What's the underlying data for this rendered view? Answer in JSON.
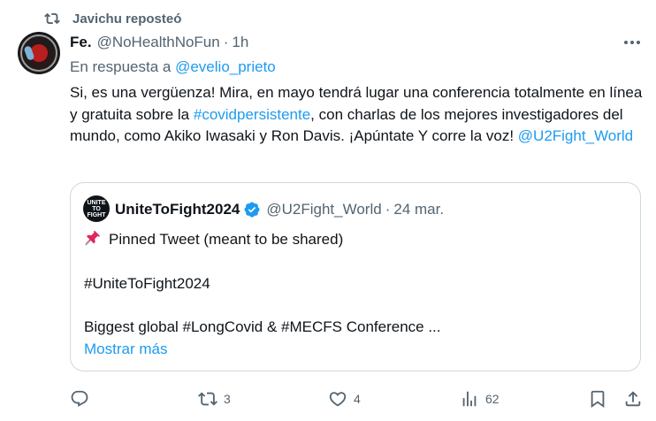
{
  "repost": {
    "icon": "repost-icon",
    "label": "Javichu reposteó"
  },
  "tweet": {
    "author_name": "Fe.",
    "handle": "@NoHealthNoFun",
    "separator": "·",
    "time": "1h",
    "more_icon": "more-dots-icon",
    "reply_prefix": "En respuesta a",
    "reply_handle": "@evelio_prieto",
    "text_part1": "Si, es una vergüenza! Mira, en mayo tendrá lugar una conferencia totalmente en línea y gratuita sobre la ",
    "hashtag": "#covidpersistente",
    "text_part2": ", con charlas de los mejores investigadores del mundo, como Akiko Iwasaki y Ron Davis. ¡Apúntate Y corre la voz! ",
    "mention": "@U2Fight_World"
  },
  "quote": {
    "avatar_text": "UNITE TO FIGHT",
    "author_name": "UniteToFight2024",
    "verified_icon": "verified-badge-icon",
    "handle": "@U2Fight_World",
    "separator": "·",
    "time": "24 mar.",
    "pin_icon": "pushpin-icon",
    "line1": "Pinned Tweet (meant to be shared)",
    "line2": "#UniteToFight2024",
    "line3": "Biggest global #LongCovid & #MECFS Conference ...",
    "show_more": "Mostrar más"
  },
  "actions": {
    "reply": {
      "icon": "reply-icon",
      "count": ""
    },
    "repost": {
      "icon": "repost-icon",
      "count": "3"
    },
    "like": {
      "icon": "heart-icon",
      "count": "4"
    },
    "views": {
      "icon": "views-chart-icon",
      "count": "62"
    },
    "bookmark": {
      "icon": "bookmark-icon"
    },
    "share": {
      "icon": "share-icon"
    }
  },
  "colors": {
    "accent": "#1d9bf0",
    "muted": "#536471",
    "text": "#0f1419",
    "border": "#cfd9de"
  }
}
